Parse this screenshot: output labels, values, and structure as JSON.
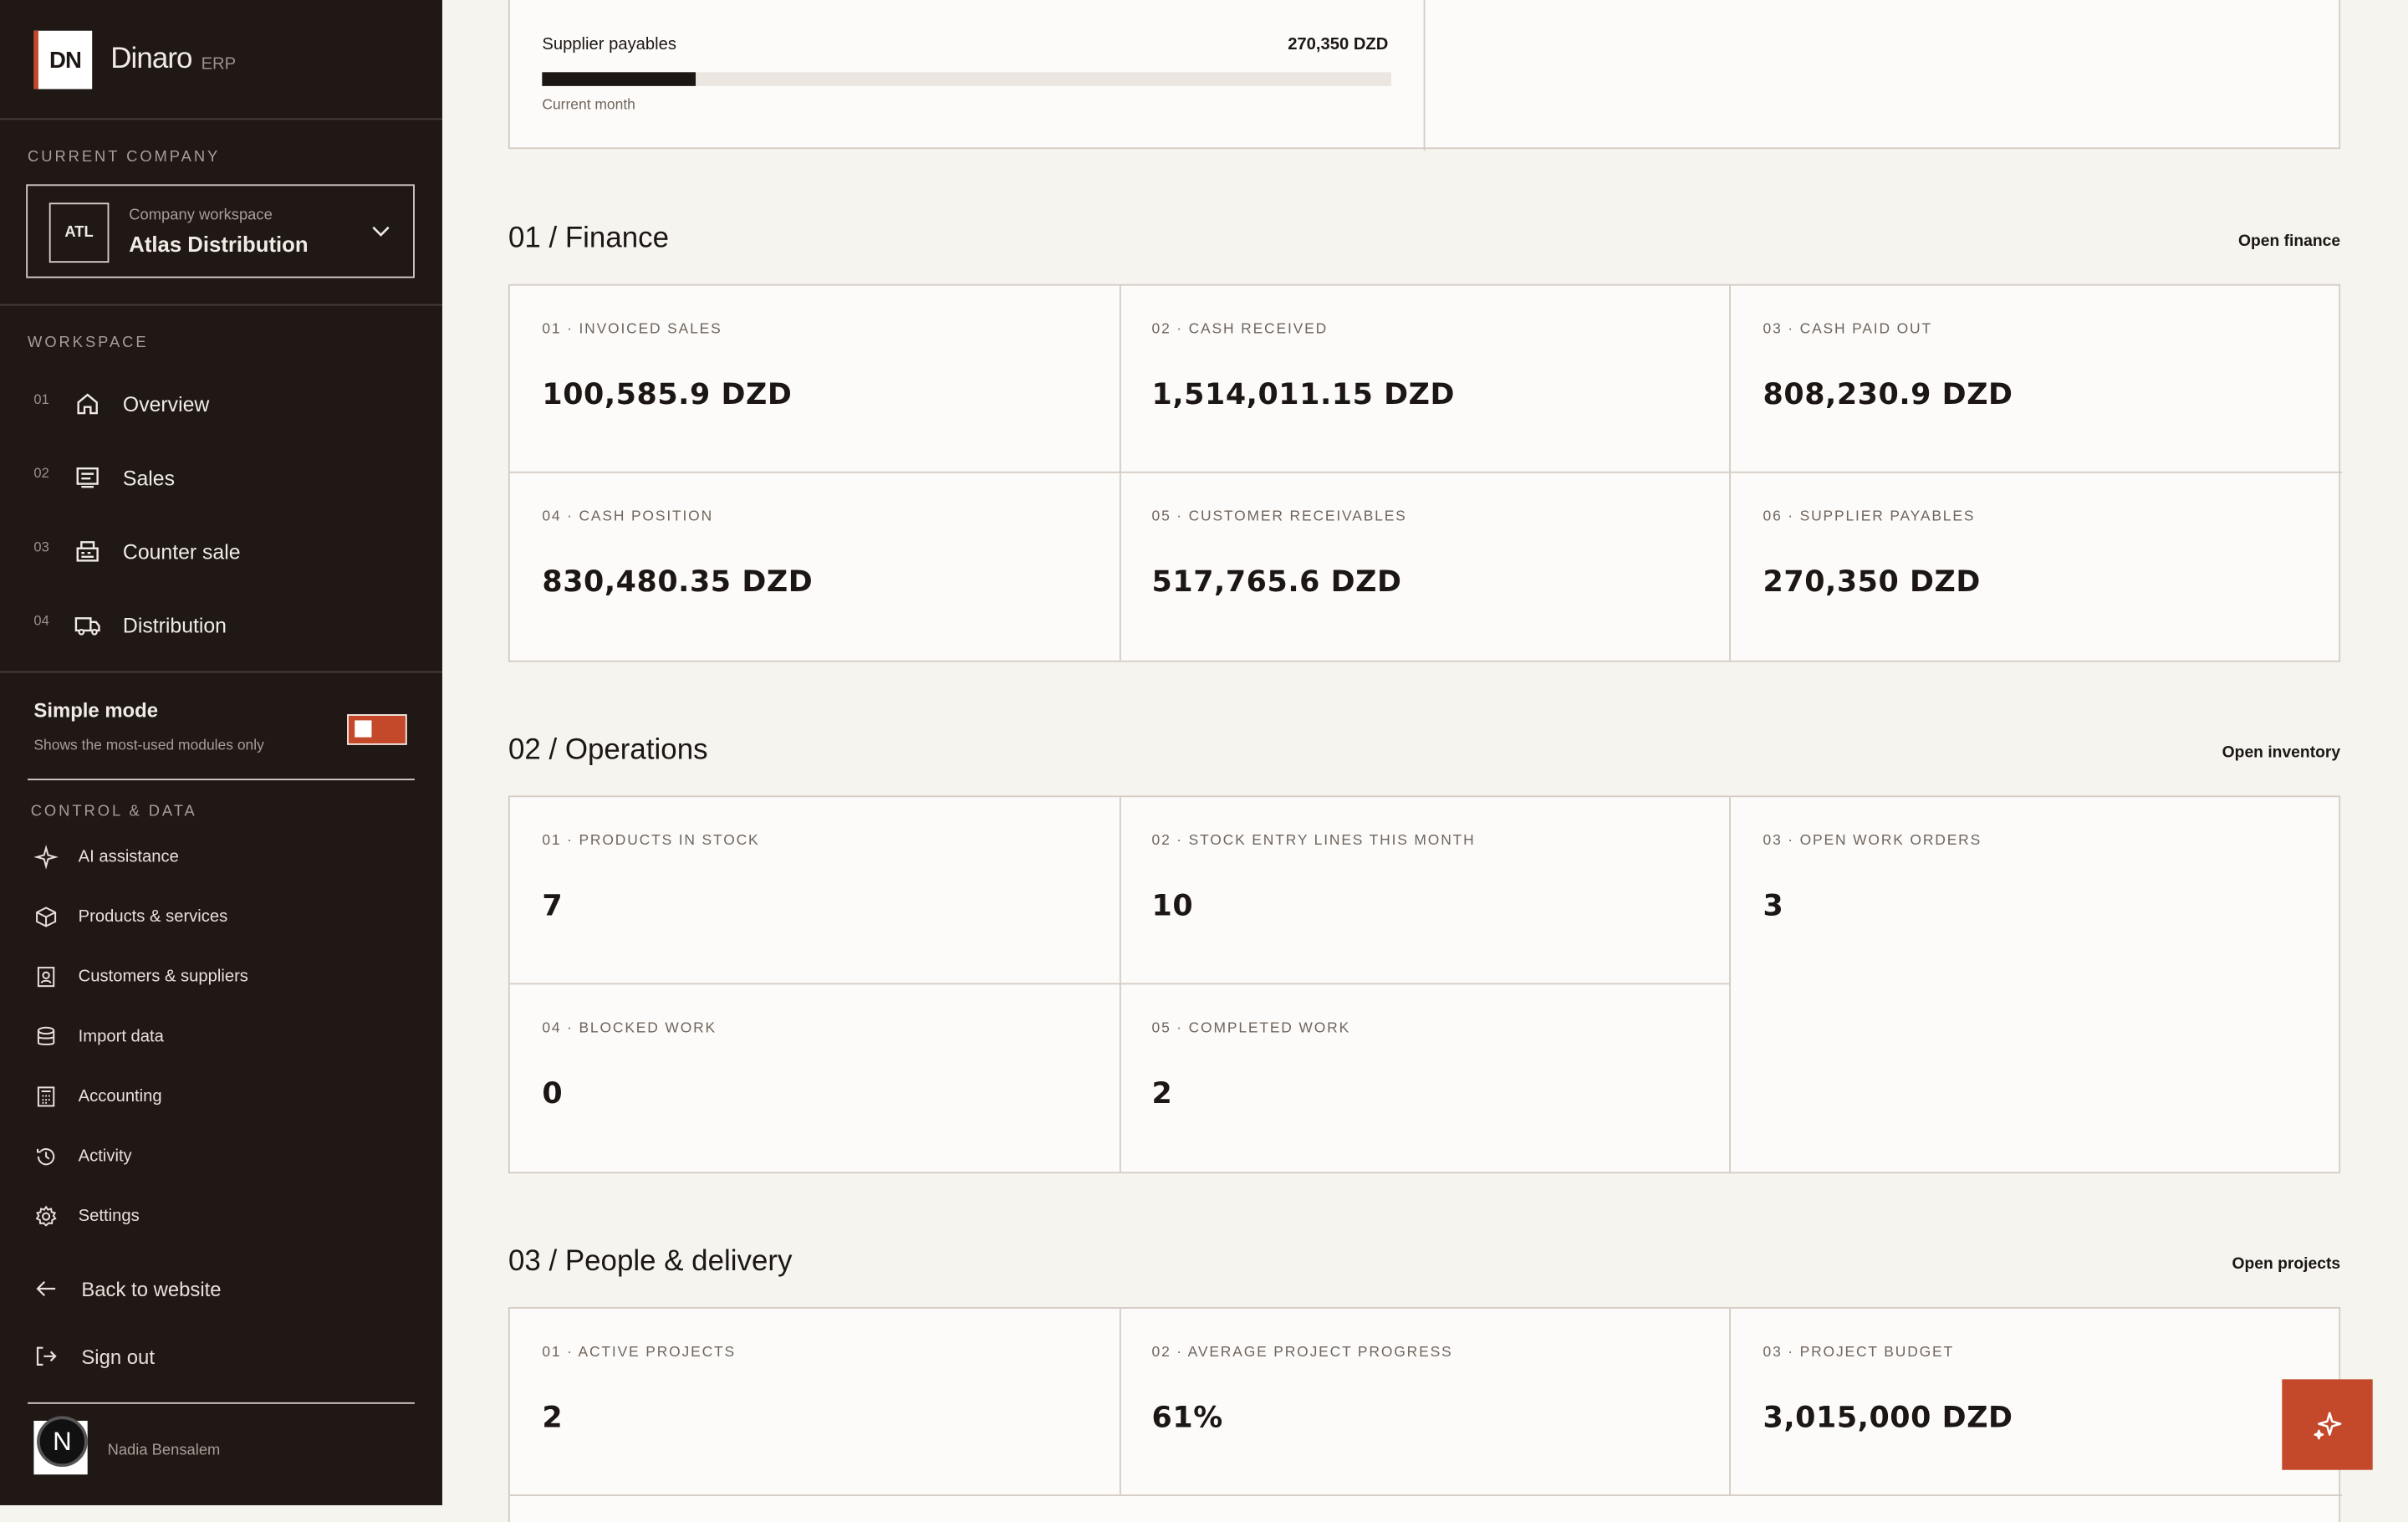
{
  "brand": {
    "logo": "DN",
    "name": "Dinaro",
    "sub": "ERP"
  },
  "company": {
    "section_label": "CURRENT COMPANY",
    "code": "ATL",
    "caption": "Company workspace",
    "name": "Atlas Distribution"
  },
  "workspace": {
    "section_label": "WORKSPACE",
    "items": [
      {
        "num": "01",
        "label": "Overview",
        "icon": "home-icon"
      },
      {
        "num": "02",
        "label": "Sales",
        "icon": "receipt-icon"
      },
      {
        "num": "03",
        "label": "Counter sale",
        "icon": "register-icon"
      },
      {
        "num": "04",
        "label": "Distribution",
        "icon": "truck-icon"
      }
    ]
  },
  "simple_mode": {
    "title": "Simple mode",
    "subtitle": "Shows the most-used modules only",
    "enabled": true
  },
  "control": {
    "section_label": "CONTROL & DATA",
    "items": [
      {
        "label": "AI assistance",
        "icon": "sparkle-icon"
      },
      {
        "label": "Products & services",
        "icon": "box-icon"
      },
      {
        "label": "Customers & suppliers",
        "icon": "contacts-icon"
      },
      {
        "label": "Import data",
        "icon": "database-icon"
      },
      {
        "label": "Accounting",
        "icon": "calculator-icon"
      },
      {
        "label": "Activity",
        "icon": "history-icon"
      },
      {
        "label": "Settings",
        "icon": "gear-icon"
      }
    ]
  },
  "bottom": {
    "back": "Back to website",
    "signout": "Sign out"
  },
  "user": {
    "initial": "N",
    "name": "Nadia Bensalem"
  },
  "top_card": {
    "label": "Supplier payables",
    "value": "270,350 DZD",
    "progress": 0.18,
    "note": "Current month"
  },
  "finance": {
    "title": "01 / Finance",
    "link": "Open finance",
    "cells": [
      {
        "label": "01 · INVOICED SALES",
        "value": "100,585.9 DZD"
      },
      {
        "label": "02 · CASH RECEIVED",
        "value": "1,514,011.15 DZD"
      },
      {
        "label": "03 · CASH PAID OUT",
        "value": "808,230.9 DZD"
      },
      {
        "label": "04 · CASH POSITION",
        "value": "830,480.35 DZD"
      },
      {
        "label": "05 · CUSTOMER RECEIVABLES",
        "value": "517,765.6 DZD"
      },
      {
        "label": "06 · SUPPLIER PAYABLES",
        "value": "270,350 DZD"
      }
    ]
  },
  "operations": {
    "title": "02 / Operations",
    "link": "Open inventory",
    "cells": [
      {
        "label": "01 · PRODUCTS IN STOCK",
        "value": "7"
      },
      {
        "label": "02 · STOCK ENTRY LINES THIS MONTH",
        "value": "10"
      },
      {
        "label": "03 · OPEN WORK ORDERS",
        "value": "3"
      },
      {
        "label": "04 · BLOCKED WORK",
        "value": "0"
      },
      {
        "label": "05 · COMPLETED WORK",
        "value": "2"
      }
    ]
  },
  "people": {
    "title": "03 / People & delivery",
    "link": "Open projects",
    "cells": [
      {
        "label": "01 · ACTIVE PROJECTS",
        "value": "2"
      },
      {
        "label": "02 · AVERAGE PROJECT PROGRESS",
        "value": "61%"
      },
      {
        "label": "03 · PROJECT BUDGET",
        "value": "3,015,000 DZD"
      }
    ]
  },
  "colors": {
    "accent": "#c4492a",
    "sidebar": "#1f1815",
    "background": "#f6f4ef"
  }
}
